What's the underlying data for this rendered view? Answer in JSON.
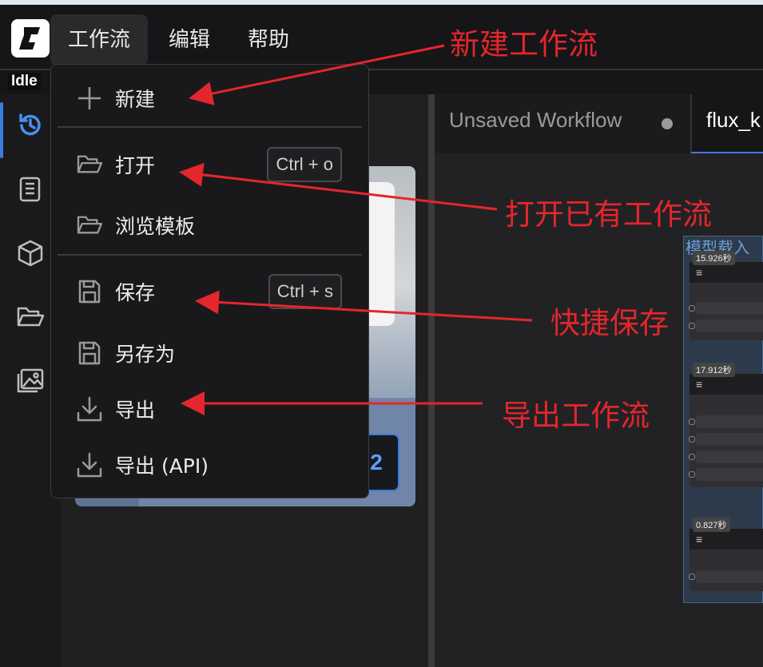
{
  "app": {
    "logo_icon": "comfy-logo-icon",
    "status": "Idle"
  },
  "menubar": {
    "items": [
      {
        "label": "工作流",
        "active": true
      },
      {
        "label": "编辑",
        "active": false
      },
      {
        "label": "帮助",
        "active": false
      }
    ]
  },
  "sidebar": {
    "items": [
      {
        "icon": "history-icon",
        "active": true
      },
      {
        "icon": "book-icon",
        "active": false
      },
      {
        "icon": "cube-icon",
        "active": false
      },
      {
        "icon": "folder-open-icon",
        "active": false
      },
      {
        "icon": "images-icon",
        "active": false
      }
    ]
  },
  "queue": {
    "count_badge": "2"
  },
  "tabs": [
    {
      "label": "Unsaved Workflow",
      "unsaved": true
    },
    {
      "label": "flux_k",
      "active": true
    }
  ],
  "canvas": {
    "group_title": "模型载入",
    "nodes": [
      {
        "time": "15.926秒"
      },
      {
        "time": "17.912秒"
      },
      {
        "time": "0.827秒"
      }
    ]
  },
  "workflow_menu": {
    "new": {
      "label": "新建",
      "icon": "plus-icon"
    },
    "open": {
      "label": "打开",
      "shortcut": "Ctrl + o",
      "icon": "folder-open-icon"
    },
    "browse_templates": {
      "label": "浏览模板",
      "icon": "folder-open-icon"
    },
    "save": {
      "label": "保存",
      "shortcut": "Ctrl + s",
      "icon": "floppy-icon"
    },
    "save_as": {
      "label": "另存为",
      "icon": "floppy-icon"
    },
    "export": {
      "label": "导出",
      "icon": "download-icon"
    },
    "export_api": {
      "label": "导出 (API)",
      "icon": "download-icon"
    }
  },
  "annotations": {
    "new": "新建工作流",
    "open": "打开已有工作流",
    "save": "快捷保存",
    "export": "导出工作流",
    "color": "#e4262d"
  }
}
